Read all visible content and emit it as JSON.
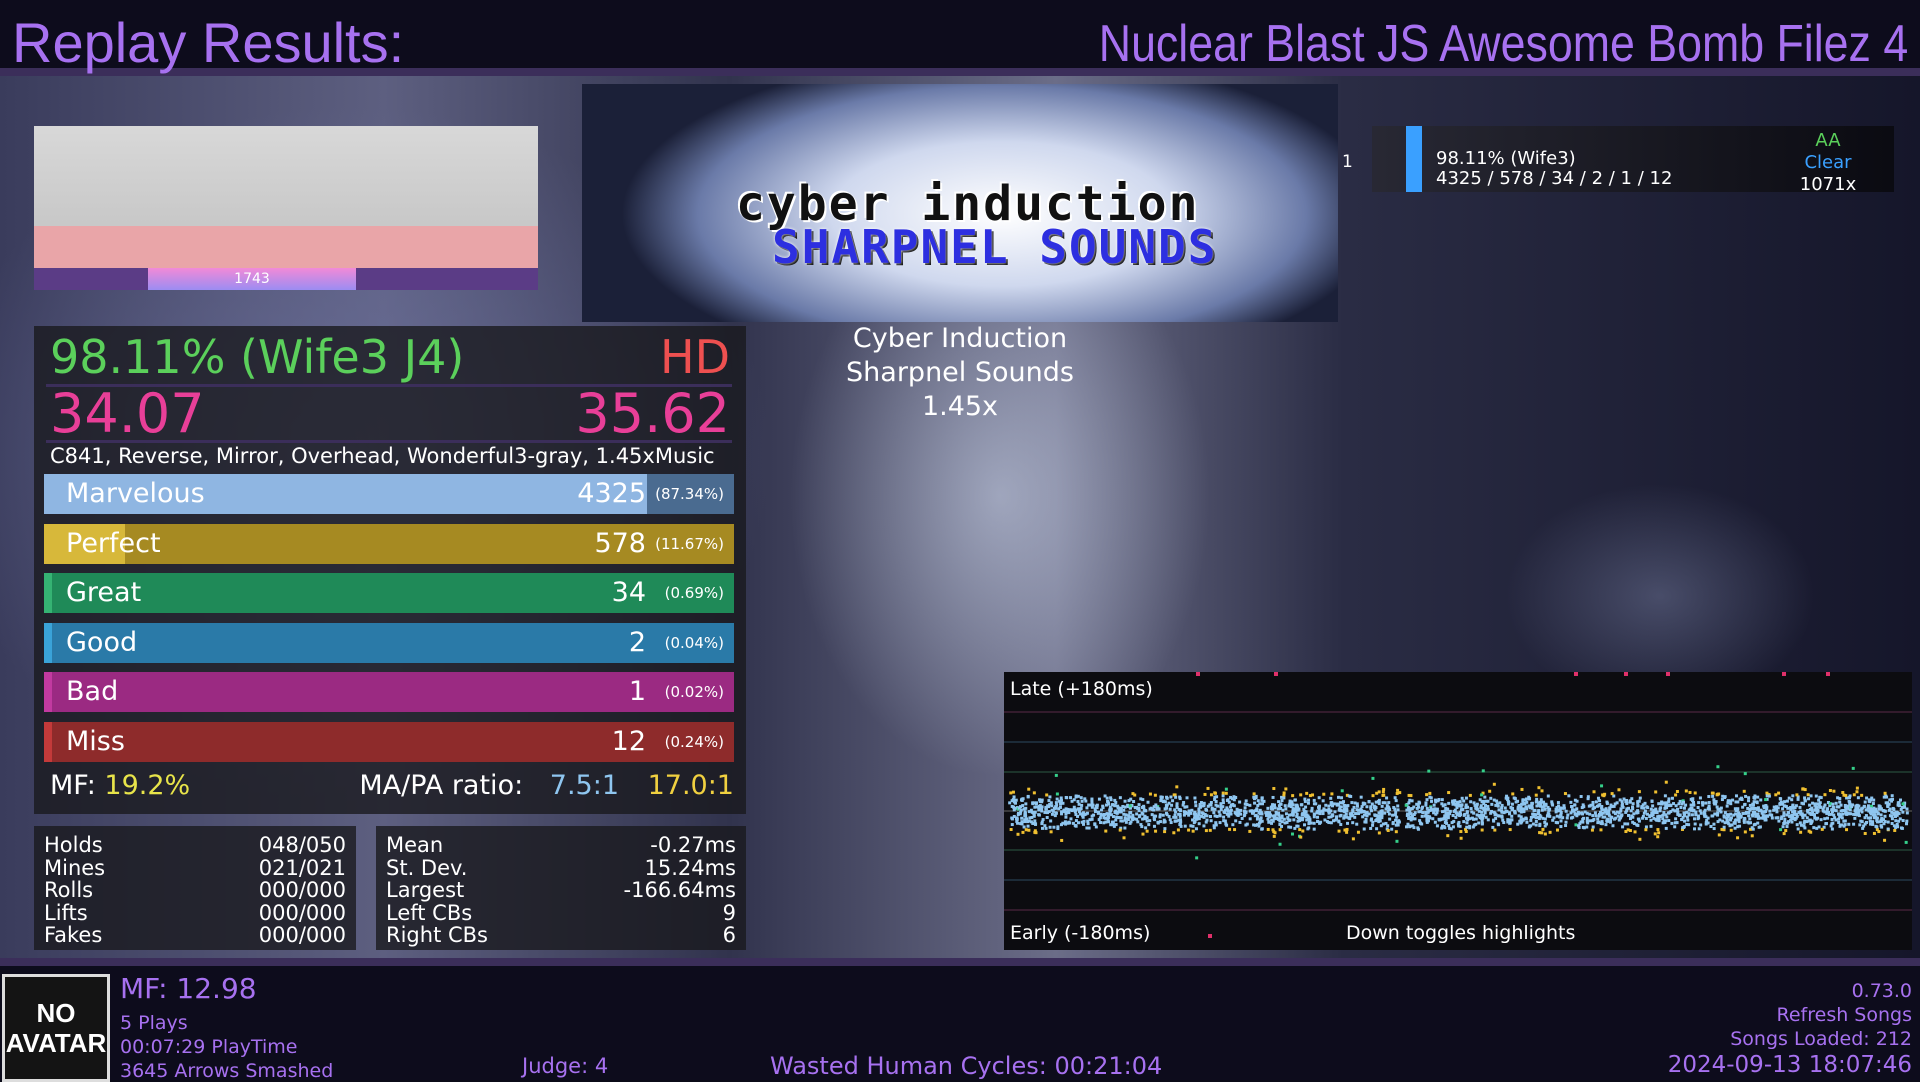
{
  "header": {
    "title": "Replay Results:",
    "pack": "Nuclear Blast JS Awesome Bomb Filez 4"
  },
  "preview": {
    "label": "1743"
  },
  "banner": {
    "line1": "cyber induction",
    "line2": "SHARPNEL SOUNDS"
  },
  "song": {
    "title": "Cyber Induction",
    "artist": "Sharpnel Sounds",
    "rate": "1.45x"
  },
  "score": {
    "accuracy": "98.11% (Wife3 J4)",
    "grade": "HD",
    "msd": "34.07",
    "ssr": "35.62",
    "mods": "C841, Reverse, Mirror, Overhead, Wonderful3-gray, 1.45xMusic",
    "judgments": [
      {
        "name": "Marvelous",
        "count": "4325",
        "pct": "(87.34%)",
        "fraction": 0.8734,
        "color": "#8fb6e2",
        "bg": "#4a6b90"
      },
      {
        "name": "Perfect",
        "count": "578",
        "pct": "(11.67%)",
        "fraction": 0.1167,
        "color": "#d7b83a",
        "bg": "#a68a22"
      },
      {
        "name": "Great",
        "count": "34",
        "pct": "(0.69%)",
        "fraction": 0.0069,
        "color": "#35b373",
        "bg": "#1f8a58"
      },
      {
        "name": "Good",
        "count": "2",
        "pct": "(0.04%)",
        "fraction": 0.0004,
        "color": "#3aa3d8",
        "bg": "#2a7aa8"
      },
      {
        "name": "Bad",
        "count": "1",
        "pct": "(0.02%)",
        "fraction": 0.0002,
        "color": "#c23aa0",
        "bg": "#9b2a82"
      },
      {
        "name": "Miss",
        "count": "12",
        "pct": "(0.24%)",
        "fraction": 0.0024,
        "color": "#c33a3a",
        "bg": "#8e2b2b"
      }
    ],
    "mf_label": "MF:",
    "mf_value": "19.2%",
    "ratio_label": "MA/PA ratio:",
    "ma_ratio": "7.5:1",
    "pa_ratio": "17.0:1"
  },
  "counts": [
    {
      "label": "Holds",
      "value": "048/050"
    },
    {
      "label": "Mines",
      "value": "021/021"
    },
    {
      "label": "Rolls",
      "value": "000/000"
    },
    {
      "label": "Lifts",
      "value": "000/000"
    },
    {
      "label": "Fakes",
      "value": "000/000"
    }
  ],
  "offsets": [
    {
      "label": "Mean",
      "value": "-0.27ms"
    },
    {
      "label": "St. Dev.",
      "value": "15.24ms"
    },
    {
      "label": "Largest",
      "value": "-166.64ms"
    },
    {
      "label": "Left CBs",
      "value": "9"
    },
    {
      "label": "Right CBs",
      "value": "6"
    }
  ],
  "scoreboard": [
    {
      "index": "1",
      "line1": "98.11% (Wife3)",
      "line2": "4325 / 578 / 34 / 2 / 1 / 12",
      "grade": "AA",
      "clear": "Clear",
      "combo": "1071x"
    }
  ],
  "plot": {
    "late_label": "Late (+180ms)",
    "early_label": "Early (-180ms)",
    "toggle_hint": "Down toggles highlights"
  },
  "profile": {
    "avatar_line1": "NO",
    "avatar_line2": "AVATAR",
    "mf": "MF: 12.98",
    "plays": "5 Plays",
    "playtime": "00:07:29 PlayTime",
    "arrows": "3645 Arrows Smashed"
  },
  "footer": {
    "judge": "Judge: 4",
    "wasted": "Wasted Human Cycles: 00:21:04",
    "version": "0.73.0",
    "refresh": "Refresh Songs",
    "loaded": "Songs Loaded: 212",
    "datetime": "2024-09-13 18:07:46"
  },
  "colors": {
    "accent": "#a771f0",
    "marvelous": "#8fb6e2",
    "perfect": "#f0c030",
    "great": "#35d08a",
    "miss": "#e0306a"
  }
}
